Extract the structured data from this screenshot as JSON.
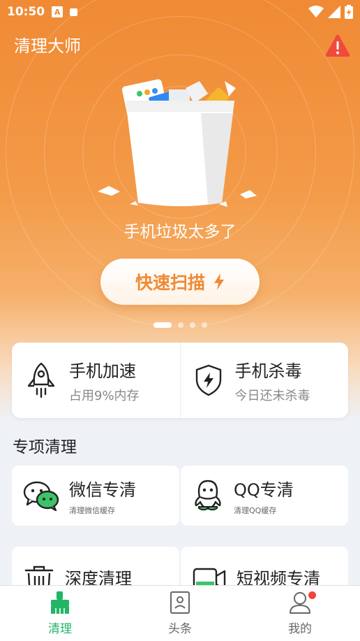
{
  "status_bar": {
    "time": "10:50",
    "a_badge": "A"
  },
  "app": {
    "title": "清理大师"
  },
  "hero": {
    "message": "手机垃圾太多了",
    "scan_button": "快速扫描",
    "page_dots": 4,
    "active_dot": 0
  },
  "quick_actions": [
    {
      "title": "手机加速",
      "subtitle": "占用9%内存",
      "icon": "rocket-icon"
    },
    {
      "title": "手机杀毒",
      "subtitle": "今日还未杀毒",
      "icon": "shield-icon"
    }
  ],
  "special": {
    "title": "专项清理",
    "items": [
      {
        "title": "微信专清",
        "subtitle": "清理微信缓存",
        "icon": "wechat-icon"
      },
      {
        "title": "QQ专清",
        "subtitle": "清理QQ缓存",
        "icon": "qq-icon"
      },
      {
        "title": "深度清理",
        "subtitle": "",
        "icon": "trash-icon"
      },
      {
        "title": "短视频专清",
        "subtitle": "",
        "icon": "video-icon"
      }
    ]
  },
  "tabs": [
    {
      "label": "清理",
      "icon": "broom-icon",
      "active": true
    },
    {
      "label": "头条",
      "icon": "news-icon",
      "active": false
    },
    {
      "label": "我的",
      "icon": "user-icon",
      "active": false,
      "badge": true
    }
  ],
  "colors": {
    "accent": "#f08a34",
    "green": "#22b566",
    "badge": "#f2453d"
  }
}
